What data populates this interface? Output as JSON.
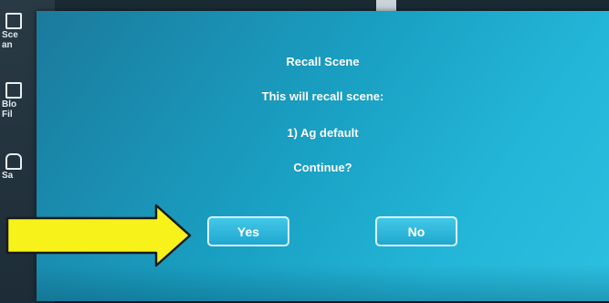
{
  "background": {
    "sidebar_items": [
      {
        "label": "Sce\nan",
        "icon": "scene-icon"
      },
      {
        "label": "Blo\nFil",
        "icon": "block-filter-icon"
      },
      {
        "label": "Sa",
        "icon": "lock-icon"
      }
    ]
  },
  "dialog": {
    "title": "Recall Scene",
    "message": "This will recall scene:",
    "scene": "1) Ag default",
    "prompt": "Continue?",
    "yes_label": "Yes",
    "no_label": "No"
  },
  "annotation": {
    "arrow_color": "#f7f21a",
    "arrow_outline": "#1a1a1a"
  }
}
